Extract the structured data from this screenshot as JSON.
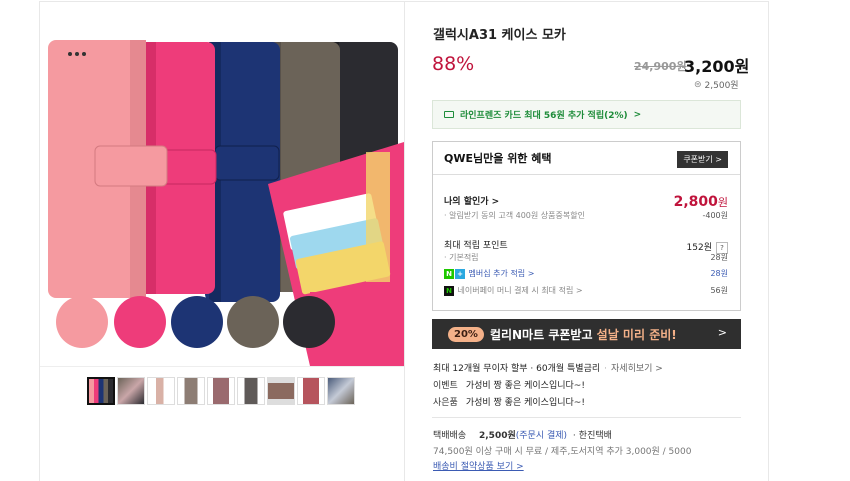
{
  "product": {
    "title": "갤럭시A31 케이스 모카",
    "discount_rate": "88%",
    "original_price": "24,900원",
    "sale_price": "3,200",
    "sale_unit": "원",
    "point": "2,500원"
  },
  "card_promo": {
    "text": "라인프렌즈 카드 최대 56원 추가 적립(2%)",
    "arrow": ">"
  },
  "benefit": {
    "title": "QWE님만을 위한 혜택",
    "coupon_button": "쿠폰받기 >",
    "my_price_label": "나의 할인가 >",
    "my_price_value": "2,800",
    "my_price_unit": "원",
    "alarm_label": "알림받기 동의 고객 400원 상품중복할인",
    "alarm_value": "-400원",
    "max_point_label": "최대 적립 포인트",
    "max_point_value": "152원",
    "help": "?",
    "basic_label": "기본적립",
    "basic_value": "28원",
    "membership_label": "멤버십 추가 적립 >",
    "membership_value": "28원",
    "npay_label": "네이버페이 머니 결제 시 최대 적립 >",
    "npay_value": "56원"
  },
  "banner": {
    "pct": "20%",
    "text_a": "컬리N마트 쿠폰받고 ",
    "text_b": "설날 미리 준비!",
    "arrow": ">"
  },
  "info": {
    "installment_a": "최대 12개월 무이자 할부",
    "installment_b": "60개월 특별금리",
    "installment_more": "자세히보기 >",
    "event_label": "이벤트",
    "event_text": "가성비 짱 좋은 케이스입니다~!",
    "gift_label": "사은품",
    "gift_text": "가성비 짱 좋은 케이스입니다~!"
  },
  "shipping": {
    "label": "택배배송",
    "fee": "2,500원",
    "pay_note": "(주문시 결제)",
    "carrier": "한진택배",
    "condition": "74,500원 이상 구매 시 무료 / 제주,도서지역 추가 3,000원 / 5000",
    "saver_link": "배송비 절약상품 보기 >"
  },
  "colors": {
    "accent_red": "#c0143c",
    "green": "#1e8c3a",
    "case_colors": [
      "#f59aa0",
      "#ee3c7a",
      "#1d3474",
      "#6b6358",
      "#2b2b30"
    ]
  },
  "thumbnails": [
    "thumb-1",
    "thumb-2",
    "thumb-3",
    "thumb-4",
    "thumb-5",
    "thumb-6",
    "thumb-7",
    "thumb-8",
    "thumb-9"
  ]
}
